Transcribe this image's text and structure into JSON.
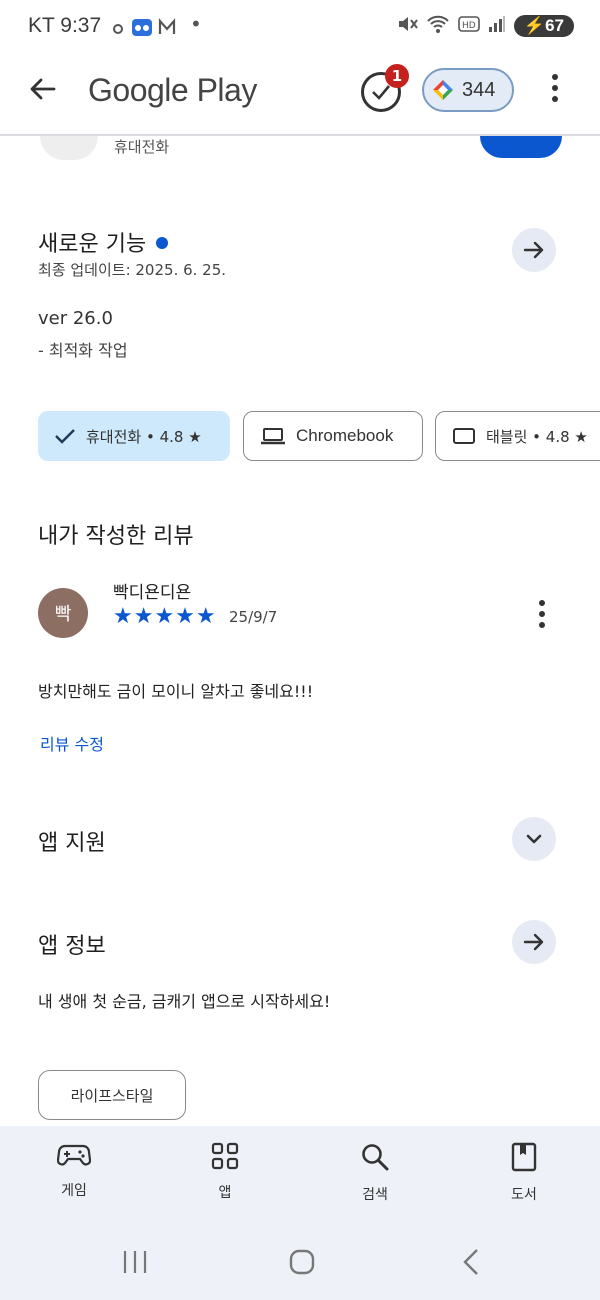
{
  "status_bar": {
    "carrier_time": "KT 9:37",
    "notif_dot": "•",
    "battery": "67"
  },
  "app_bar": {
    "brand": "Google Play",
    "badge_count": "1",
    "points": "344"
  },
  "peek": {
    "device_label": "휴대전화"
  },
  "whats_new": {
    "title": "새로운 기능",
    "updated": "최종 업데이트: 2025. 6. 25.",
    "version": "ver 26.0",
    "notes": "- 최적화 작업"
  },
  "device_chips": [
    {
      "label": "휴대전화 • 4.8 ★"
    },
    {
      "label": "Chromebook"
    },
    {
      "label": "태블릿 • 4.8 ★"
    }
  ],
  "my_review": {
    "title": "내가 작성한 리뷰",
    "author": "빡디욘디욘",
    "avatar_text": "빡",
    "rating": 5,
    "stars": "★★★★★",
    "date": "25/9/7",
    "text": "방치만해도 금이 모이니 알차고 좋네요!!!",
    "edit_link": "리뷰 수정"
  },
  "app_support": {
    "title": "앱 지원"
  },
  "app_info": {
    "title": "앱 정보",
    "description": "내 생애 첫 순금, 금캐기 앱으로 시작하세요!"
  },
  "category_chip": "라이프스타일",
  "bottom_nav": [
    {
      "label": "게임",
      "icon": "gamepad-icon"
    },
    {
      "label": "앱",
      "icon": "apps-grid-icon"
    },
    {
      "label": "검색",
      "icon": "search-icon"
    },
    {
      "label": "도서",
      "icon": "book-icon"
    }
  ],
  "colors": {
    "accent": "#0b57d0",
    "selected_chip": "#cde9fb",
    "nav_bg": "#eef1f8",
    "badge": "#c5221f",
    "avatar": "#8d6e63"
  }
}
